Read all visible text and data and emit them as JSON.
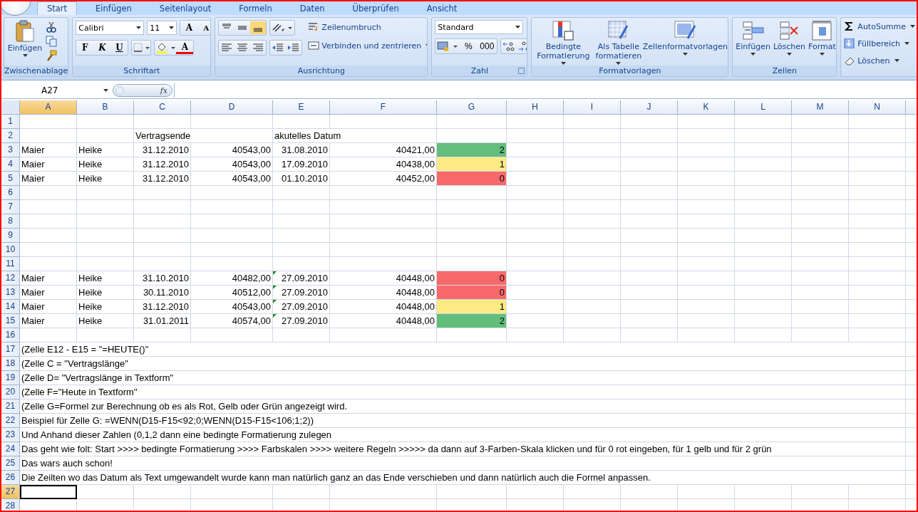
{
  "tabs": [
    {
      "label": "Start",
      "selected": true
    },
    {
      "label": "Einfügen",
      "selected": false
    },
    {
      "label": "Seitenlayout",
      "selected": false
    },
    {
      "label": "Formeln",
      "selected": false
    },
    {
      "label": "Daten",
      "selected": false
    },
    {
      "label": "Überprüfen",
      "selected": false
    },
    {
      "label": "Ansicht",
      "selected": false
    }
  ],
  "ribbon": {
    "clipboard": {
      "title": "Zwischenablage",
      "paste": "Einfügen"
    },
    "font": {
      "title": "Schriftart",
      "family": "Calibri",
      "size": "11",
      "grow": "A",
      "shrink": "A",
      "bold": "F",
      "italic": "K",
      "underline": "U",
      "color_letter": "A"
    },
    "alignment": {
      "title": "Ausrichtung",
      "wrap": "Zeilenumbruch",
      "merge": "Verbinden und zentrieren"
    },
    "number": {
      "title": "Zahl",
      "format": "Standard",
      "percent": "%",
      "thousands": "000"
    },
    "styles": {
      "title": "Formatvorlagen",
      "conditional": [
        "Bedingte",
        "Formatierung"
      ],
      "table": [
        "Als Tabelle",
        "formatieren"
      ],
      "cell_styles": "Zellenformatvorlagen"
    },
    "cells": {
      "title": "Zellen",
      "insert": "Einfügen",
      "delete": "Löschen",
      "format": "Format"
    },
    "editing": {
      "autosum": "AutoSumme",
      "fill": "Füllbereich",
      "clear": "Löschen"
    }
  },
  "formula_bar": {
    "name_box": "A27",
    "fx": "fx"
  },
  "sheet": {
    "columns": [
      {
        "label": "A",
        "selected": true
      },
      {
        "label": "B",
        "selected": false
      },
      {
        "label": "C",
        "selected": false
      },
      {
        "label": "D",
        "selected": false
      },
      {
        "label": "E",
        "selected": false
      },
      {
        "label": "F",
        "selected": false
      },
      {
        "label": "G",
        "selected": false
      },
      {
        "label": "H",
        "selected": false
      },
      {
        "label": "I",
        "selected": false
      },
      {
        "label": "J",
        "selected": false
      },
      {
        "label": "K",
        "selected": false
      },
      {
        "label": "L",
        "selected": false
      },
      {
        "label": "M",
        "selected": false
      },
      {
        "label": "N",
        "selected": false
      }
    ],
    "rows": [
      {
        "kind": "empty",
        "label": "1",
        "selected": false
      },
      {
        "kind": "labels",
        "label": "2",
        "selected": false,
        "end_label": "Vertragsende",
        "current_label": "akutelles Datum"
      },
      {
        "kind": "data",
        "label": "3",
        "selected": false,
        "name": "Maier",
        "first_name": "Heike",
        "end_date": "31.12.2010",
        "end_value": "40543,00",
        "current_date": "31.08.2010",
        "current_value": "40421,00",
        "text_warning": false,
        "result": "2",
        "color": "#63be7b"
      },
      {
        "kind": "data",
        "label": "4",
        "selected": false,
        "name": "Maier",
        "first_name": "Heike",
        "end_date": "31.12.2010",
        "end_value": "40543,00",
        "current_date": "17.09.2010",
        "current_value": "40438,00",
        "text_warning": false,
        "result": "1",
        "color": "#ffeb84"
      },
      {
        "kind": "data",
        "label": "5",
        "selected": false,
        "name": "Maier",
        "first_name": "Heike",
        "end_date": "31.12.2010",
        "end_value": "40543,00",
        "current_date": "01.10.2010",
        "current_value": "40452,00",
        "text_warning": false,
        "result": "0",
        "color": "#f8696b"
      },
      {
        "kind": "empty",
        "label": "6",
        "selected": false
      },
      {
        "kind": "empty",
        "label": "7",
        "selected": false
      },
      {
        "kind": "empty",
        "label": "8",
        "selected": false
      },
      {
        "kind": "empty",
        "label": "9",
        "selected": false
      },
      {
        "kind": "empty",
        "label": "10",
        "selected": false
      },
      {
        "kind": "empty",
        "label": "11",
        "selected": false
      },
      {
        "kind": "data",
        "label": "12",
        "selected": false,
        "name": "Maier",
        "first_name": "Heike",
        "end_date": "31.10.2010",
        "end_value": "40482,00",
        "current_date": "27.09.2010",
        "current_value": "40448,00",
        "text_warning": true,
        "result": "0",
        "color": "#f8696b"
      },
      {
        "kind": "data",
        "label": "13",
        "selected": false,
        "name": "Maier",
        "first_name": "Heike",
        "end_date": "30.11.2010",
        "end_value": "40512,00",
        "current_date": "27.09.2010",
        "current_value": "40448,00",
        "text_warning": true,
        "result": "0",
        "color": "#f8696b"
      },
      {
        "kind": "data",
        "label": "14",
        "selected": false,
        "name": "Maier",
        "first_name": "Heike",
        "end_date": "31.12.2010",
        "end_value": "40543,00",
        "current_date": "27.09.2010",
        "current_value": "40448,00",
        "text_warning": true,
        "result": "1",
        "color": "#ffeb84"
      },
      {
        "kind": "data",
        "label": "15",
        "selected": false,
        "name": "Maier",
        "first_name": "Heike",
        "end_date": "31.01.2011",
        "end_value": "40574,00",
        "current_date": "27.09.2010",
        "current_value": "40448,00",
        "text_warning": true,
        "result": "2",
        "color": "#63be7b"
      },
      {
        "kind": "empty",
        "label": "16",
        "selected": false
      },
      {
        "kind": "note",
        "label": "17",
        "selected": false,
        "text": "(Zelle E12 - E15 = \"=HEUTE()\""
      },
      {
        "kind": "note",
        "label": "18",
        "selected": false,
        "text": "(Zelle C = \"Vertragslänge\""
      },
      {
        "kind": "note",
        "label": "19",
        "selected": false,
        "text": "(Zelle D= \"Vertragslänge in Textform\""
      },
      {
        "kind": "note",
        "label": "20",
        "selected": false,
        "text": "(Zelle F=\"Heute in Textform\""
      },
      {
        "kind": "note",
        "label": "21",
        "selected": false,
        "text": "(Zelle G=Formel zur Berechnung ob es als Rot, Gelb oder Grün angezeigt wird."
      },
      {
        "kind": "note",
        "label": "22",
        "selected": false,
        "text": "Beispiel für Zelle G: =WENN(D15-F15<92;0;WENN(D15-F15<106;1;2))"
      },
      {
        "kind": "note",
        "label": "23",
        "selected": false,
        "text": "Und Anhand dieser Zahlen (0,1,2 dann eine bedingte Formatierung zulegen"
      },
      {
        "kind": "note",
        "label": "24",
        "selected": false,
        "text": "Das geht wie folt: Start >>>> bedingte Formatierung >>>> Farbskalen >>>> weitere Regeln >>>>> da dann auf 3-Farben-Skala klicken und für 0 rot eingeben, für 1 gelb und für 2 grün"
      },
      {
        "kind": "note",
        "label": "25",
        "selected": false,
        "text": "Das wars auch schon!"
      },
      {
        "kind": "note",
        "label": "26",
        "selected": false,
        "text": "Die Zeilten wo das Datum als Text umgewandelt wurde kann man natürlich ganz an das Ende verschieben und dann natürlich auch die Formel anpassen."
      },
      {
        "kind": "empty",
        "label": "27",
        "selected": true
      },
      {
        "kind": "empty",
        "label": "28",
        "selected": false
      }
    ]
  }
}
